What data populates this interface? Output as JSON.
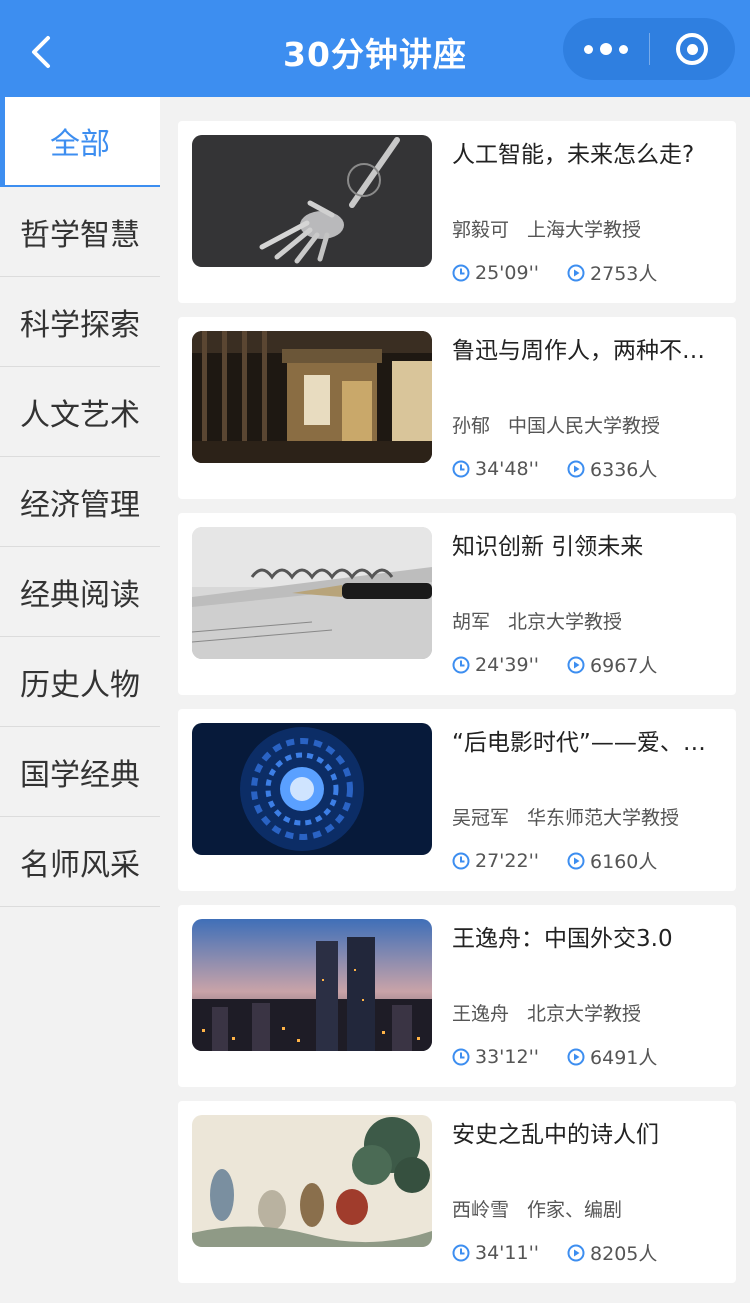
{
  "header": {
    "title": "30分钟讲座",
    "back_icon": "chevron-left-icon",
    "more_icon": "more-dots-icon",
    "close_icon": "target-circle-icon",
    "accent_color": "#3d8ef0"
  },
  "sidebar": {
    "active_index": 0,
    "items": [
      {
        "label": "全部"
      },
      {
        "label": "哲学智慧"
      },
      {
        "label": "科学探索"
      },
      {
        "label": "人文艺术"
      },
      {
        "label": "经济管理"
      },
      {
        "label": "经典阅读"
      },
      {
        "label": "历史人物"
      },
      {
        "label": "国学经典"
      },
      {
        "label": "名师风采"
      }
    ]
  },
  "lectures": [
    {
      "title": "人工智能，未来怎么走?",
      "speaker": "郭毅可",
      "affiliation": "上海大学教授",
      "duration": "25'09''",
      "views": "2753人",
      "thumbnail": "robot-hand"
    },
    {
      "title": "鲁迅与周作人，两种不…",
      "speaker": "孙郁",
      "affiliation": "中国人民大学教授",
      "duration": "34'48''",
      "views": "6336人",
      "thumbnail": "old-house"
    },
    {
      "title": "知识创新 引领未来",
      "speaker": "胡军",
      "affiliation": "北京大学教授",
      "duration": "24'39''",
      "views": "6967人",
      "thumbnail": "fountain-pen"
    },
    {
      "title": "“后电影时代”——爱、…",
      "speaker": "吴冠军",
      "affiliation": "华东师范大学教授",
      "duration": "27'22''",
      "views": "6160人",
      "thumbnail": "blue-tunnel"
    },
    {
      "title": "王逸舟：中国外交3.0",
      "speaker": "王逸舟",
      "affiliation": "北京大学教授",
      "duration": "33'12''",
      "views": "6491人",
      "thumbnail": "city-skyline"
    },
    {
      "title": "安史之乱中的诗人们",
      "speaker": "西岭雪",
      "affiliation": "作家、编剧",
      "duration": "34'11''",
      "views": "8205人",
      "thumbnail": "ink-painting"
    }
  ]
}
